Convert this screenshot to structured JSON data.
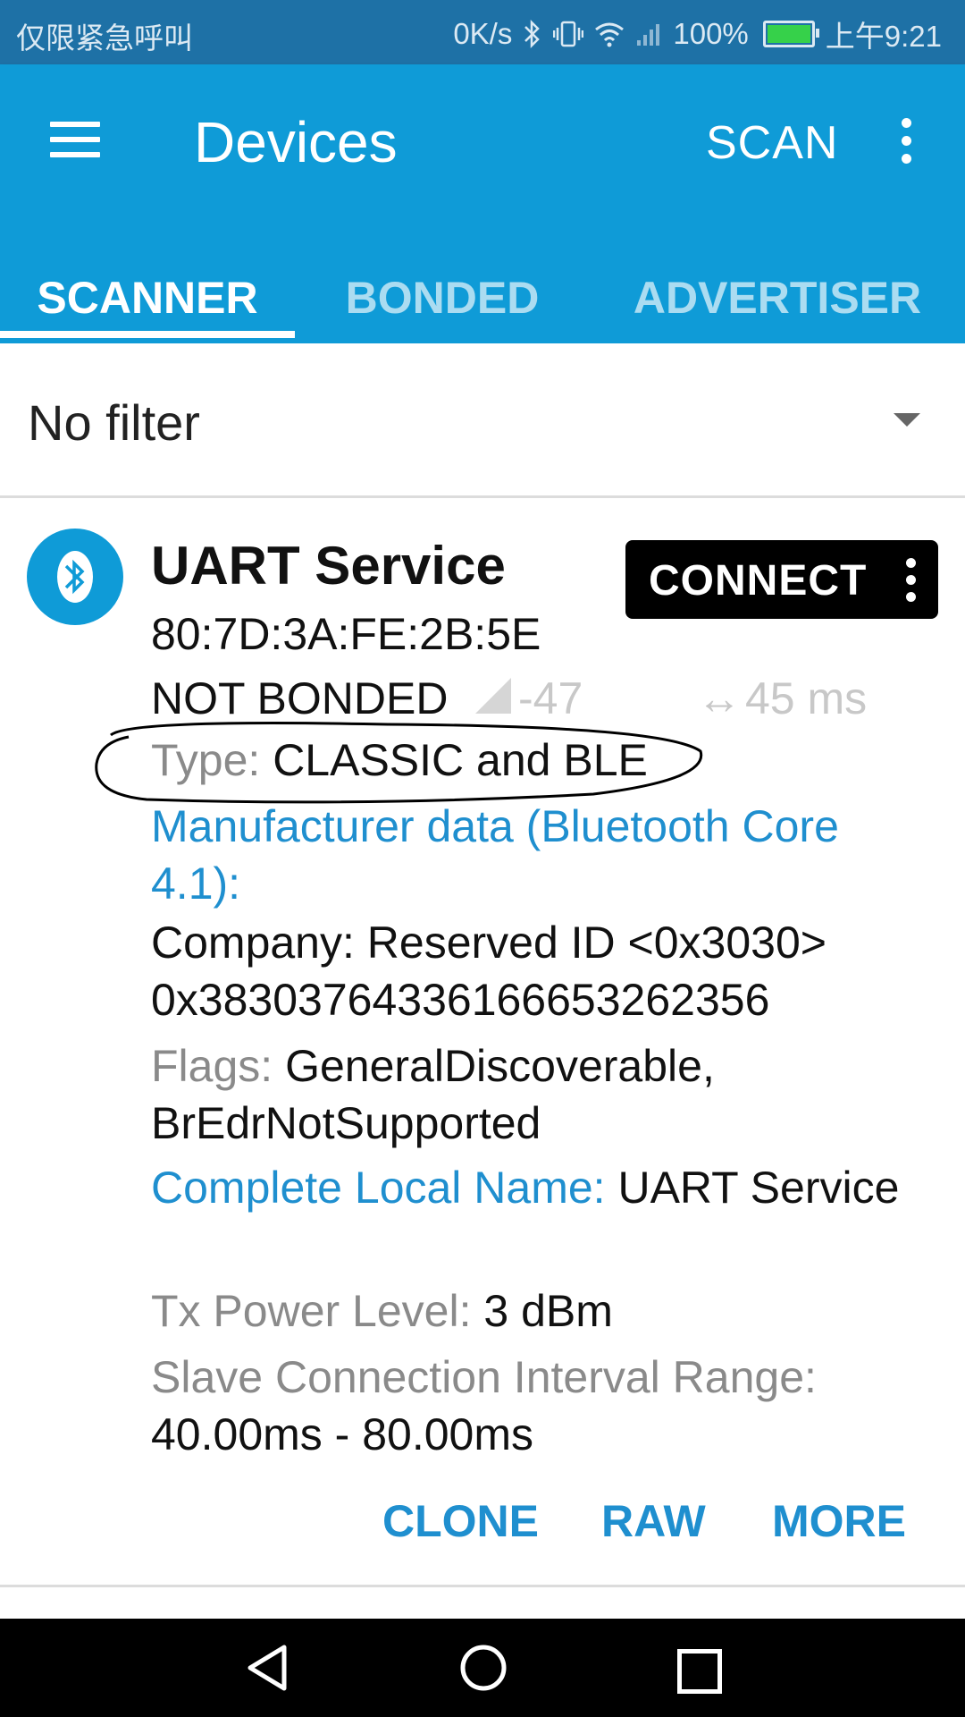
{
  "status_bar": {
    "carrier_text": "仅限紧急呼叫",
    "speed": "0K/s",
    "battery": "100%",
    "time": "上午9:21"
  },
  "app_bar": {
    "title": "Devices",
    "scan_label": "SCAN",
    "menu_icon": "menu-icon",
    "overflow_icon": "more-vert-icon"
  },
  "tabs": [
    {
      "label": "SCANNER",
      "active": true
    },
    {
      "label": "BONDED",
      "active": false
    },
    {
      "label": "ADVERTISER",
      "active": false
    }
  ],
  "filter": {
    "value": "No filter"
  },
  "device": {
    "name": "UART Service",
    "address": "80:7D:3A:FE:2B:5E",
    "bond_state": "NOT BONDED",
    "rssi": "-47",
    "interval": "45 ms",
    "connect_label": "CONNECT",
    "type_label": "Type: ",
    "type_value": "CLASSIC and BLE",
    "manufacturer_label": "Manufacturer data (Bluetooth Core 4.1):",
    "company_line": "Company: Reserved ID <0x3030>",
    "company_data": "0x38303764336166653262356",
    "flags_label": "Flags: ",
    "flags_value": "GeneralDiscoverable, BrEdrNotSupported",
    "local_name_label": "Complete Local Name: ",
    "local_name_value": "UART Service",
    "tx_power_label": "Tx Power Level: ",
    "tx_power_value": "3 dBm",
    "slave_interval_label": "Slave Connection Interval Range:",
    "slave_interval_value": "40.00ms - 80.00ms"
  },
  "actions": {
    "clone": "CLONE",
    "raw": "RAW",
    "more": "MORE"
  },
  "colors": {
    "status_bar": "#1e71a6",
    "app_bar": "#0f9bd7",
    "accent_blue": "#1f8fcf",
    "connect_button": "#000000"
  }
}
